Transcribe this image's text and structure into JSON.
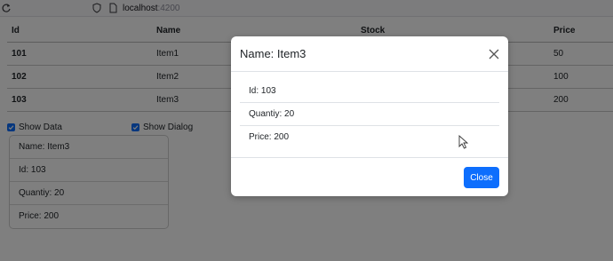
{
  "browser": {
    "url_host": "localhost",
    "url_port": ":4200"
  },
  "table": {
    "headers": [
      "Id",
      "Name",
      "Stock",
      "Price"
    ],
    "rows": [
      {
        "id": "101",
        "name": "Item1",
        "stock": "",
        "price": "50"
      },
      {
        "id": "102",
        "name": "Item2",
        "stock": "",
        "price": "100"
      },
      {
        "id": "103",
        "name": "Item3",
        "stock": "",
        "price": "200"
      }
    ]
  },
  "checkboxes": {
    "show_data": "Show Data",
    "show_dialog": "Show Dialog"
  },
  "detail_list": [
    "Name: Item3",
    "Id: 103",
    "Quantiy: 20",
    "Price: 200"
  ],
  "modal": {
    "title": "Name: Item3",
    "items": [
      "Id: 103",
      "Quantiy: 20",
      "Price: 200"
    ],
    "close_label": "Close"
  },
  "colors": {
    "primary": "#0d6efd",
    "backdrop": "rgba(0,0,0,0.5)"
  },
  "icons": [
    "reload-icon",
    "shield-icon",
    "page-icon",
    "close-icon",
    "check-icon",
    "cursor-icon"
  ]
}
